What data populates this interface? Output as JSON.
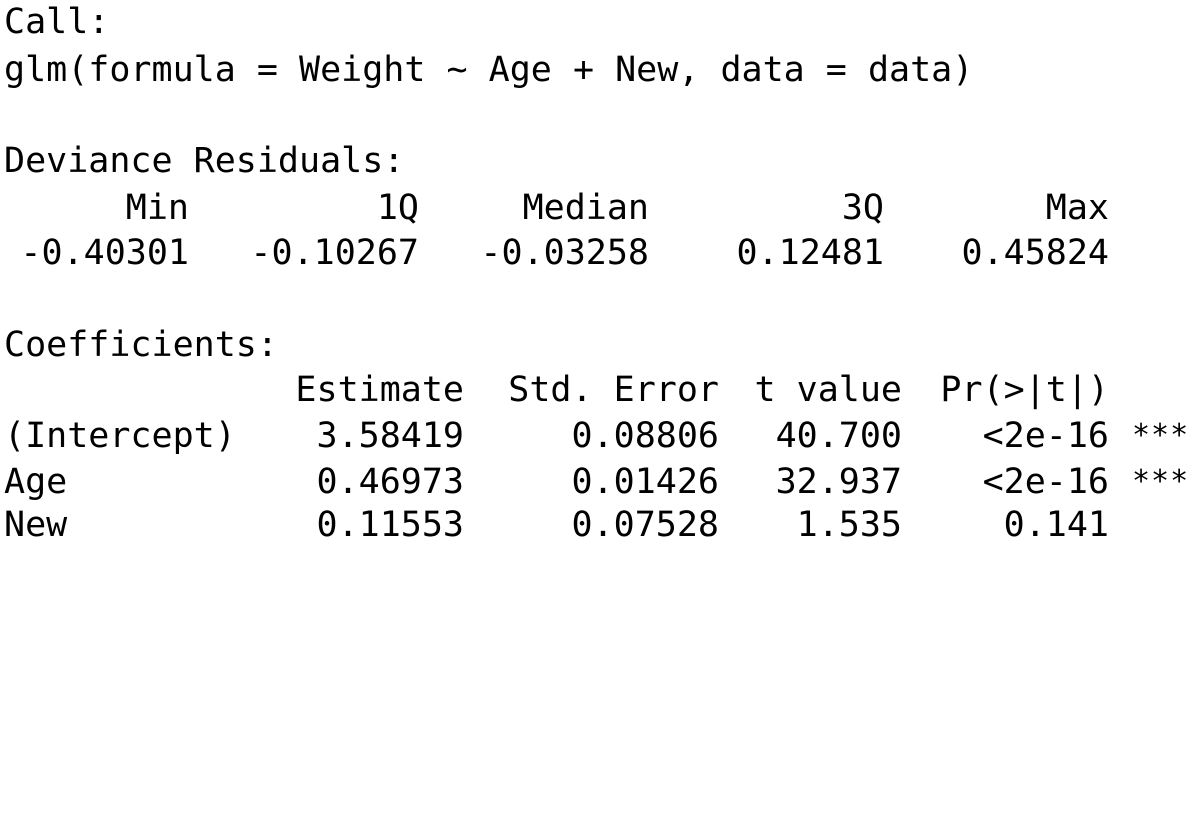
{
  "call": {
    "header": "Call:",
    "formula": "glm(formula = Weight ~ Age + New, data = data)"
  },
  "deviance_residuals": {
    "header": "Deviance Residuals:",
    "labels": [
      "Min",
      "1Q",
      "Median",
      "3Q",
      "Max"
    ],
    "values": [
      "-0.40301",
      "-0.10267",
      "-0.03258",
      "0.12481",
      "0.45824"
    ]
  },
  "coefficients": {
    "header": "Coefficients:",
    "columns": [
      "Estimate",
      "Std. Error",
      "t value",
      "Pr(>|t|)"
    ],
    "rows": [
      {
        "term": "(Intercept)",
        "estimate": "3.58419",
        "std_error": "0.08806",
        "t_value": "40.700",
        "p_value": "<2e-16",
        "signif": "***"
      },
      {
        "term": "Age",
        "estimate": "0.46973",
        "std_error": "0.01426",
        "t_value": "32.937",
        "p_value": "<2e-16",
        "signif": "***"
      },
      {
        "term": "New",
        "estimate": "0.11553",
        "std_error": "0.07528",
        "t_value": "1.535",
        "p_value": "0.141",
        "signif": ""
      }
    ]
  }
}
